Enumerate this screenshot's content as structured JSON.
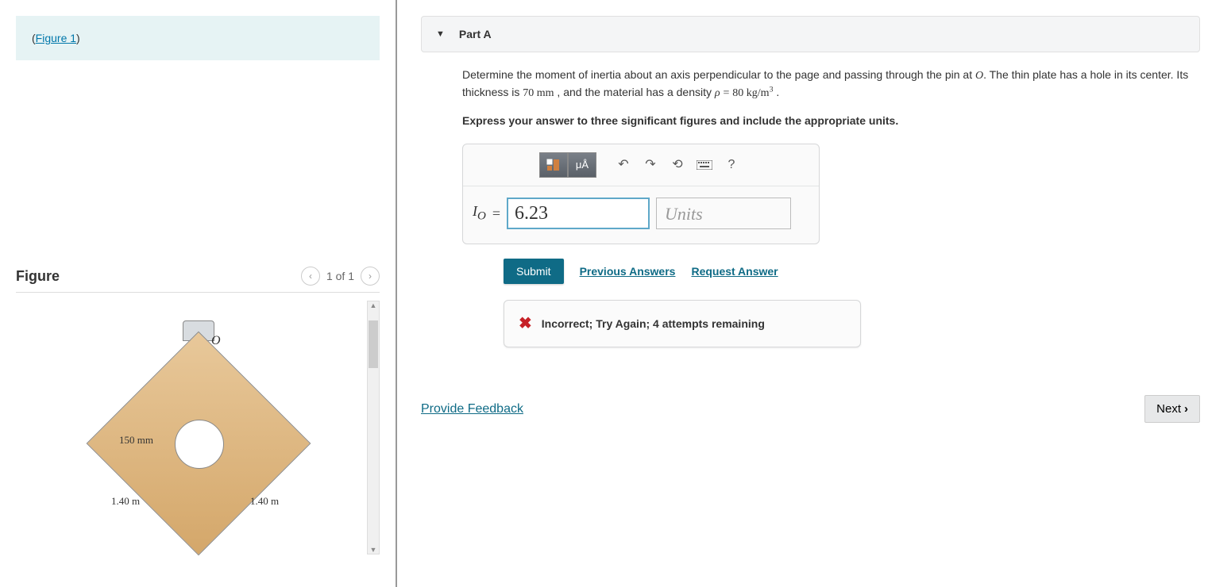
{
  "left": {
    "figure_link": "Figure 1",
    "section_title": "Figure",
    "pager": "1 of 1",
    "diagram": {
      "point_label": "O",
      "hole_radius": "150 mm",
      "side_left": "1.40 m",
      "side_right": "1.40 m"
    }
  },
  "part": {
    "title": "Part A",
    "question_prefix": "Determine the moment of inertia about an axis perpendicular to the page and passing through the pin at ",
    "point_var": "O",
    "question_mid": ". The thin plate has a hole in its center. Its thickness is ",
    "thickness": "70 mm",
    "question_mid2": " , and the material has a density ",
    "density_var": "ρ",
    "density_val": "80 kg/m",
    "density_exp": "3",
    "question_end": " .",
    "instruction": "Express your answer to three significant figures and include the appropriate units.",
    "toolbar": {
      "units_btn": "μÅ",
      "help": "?"
    },
    "answer": {
      "var": "I",
      "sub": "O",
      "eq": "=",
      "value": "6.23",
      "units_placeholder": "Units"
    },
    "actions": {
      "submit": "Submit",
      "prev": "Previous Answers",
      "request": "Request Answer"
    },
    "feedback": "Incorrect; Try Again; 4 attempts remaining",
    "provide_feedback": "Provide Feedback",
    "next": "Next"
  }
}
